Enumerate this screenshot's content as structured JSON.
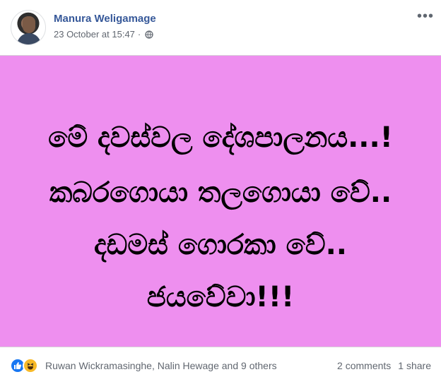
{
  "post": {
    "author_name": "Manura Weligamage",
    "timestamp": "23 October at 15:47",
    "separator": "·",
    "privacy_icon": "globe-icon",
    "more_icon": "more-options-icon",
    "more_label": "•••"
  },
  "content": {
    "background_color": "#ee8fef",
    "lines": [
      "මේ දවස්වල දේශපාලනය...!",
      "කබරගොයා තලගොයා වේ..",
      "දඩමස් ගොරකා වේ..",
      "ජයවේවා!!!"
    ]
  },
  "footer": {
    "reaction_icons": [
      "like-icon",
      "haha-icon"
    ],
    "reactors": "Ruwan Wickramasinghe, Nalin Hewage and 9 others",
    "comments": "2 comments",
    "shares": "1 share"
  }
}
